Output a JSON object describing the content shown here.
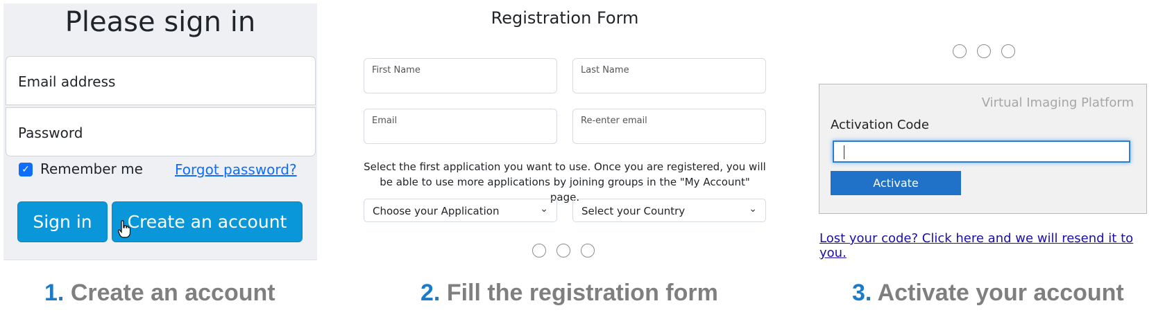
{
  "signin": {
    "title": "Please sign in",
    "email_placeholder": "Email address",
    "password_placeholder": "Password",
    "remember_checked": true,
    "remember_label": "Remember me",
    "forgot_link": "Forgot password?",
    "signin_button": "Sign in",
    "create_button": "Create an account",
    "accent_color": "#0a97d9"
  },
  "registration": {
    "title": "Registration Form",
    "fields": {
      "first_name": "First Name",
      "last_name": "Last Name",
      "email": "Email",
      "reenter_email": "Re-enter email"
    },
    "instructions": "Select the first application you want to use. Once you are registered, you will be able to use more applications by joining groups in the \"My Account\" page.",
    "application_select": "Choose your Application",
    "country_select": "Select your Country"
  },
  "activation": {
    "platform_name": "Virtual Imaging Platform",
    "code_label": "Activation Code",
    "code_value": "",
    "activate_button": "Activate",
    "lost_code_link": "Lost your code? Click here and we will resend it to you."
  },
  "captions": [
    {
      "number": "1.",
      "text": "Create an account"
    },
    {
      "number": "2.",
      "text": "Fill the registration form"
    },
    {
      "number": "3.",
      "text": "Activate your account"
    }
  ],
  "colors": {
    "caption_number": "#1b7ac9",
    "caption_text": "#7f7f7f",
    "link": "#1a0dab"
  }
}
